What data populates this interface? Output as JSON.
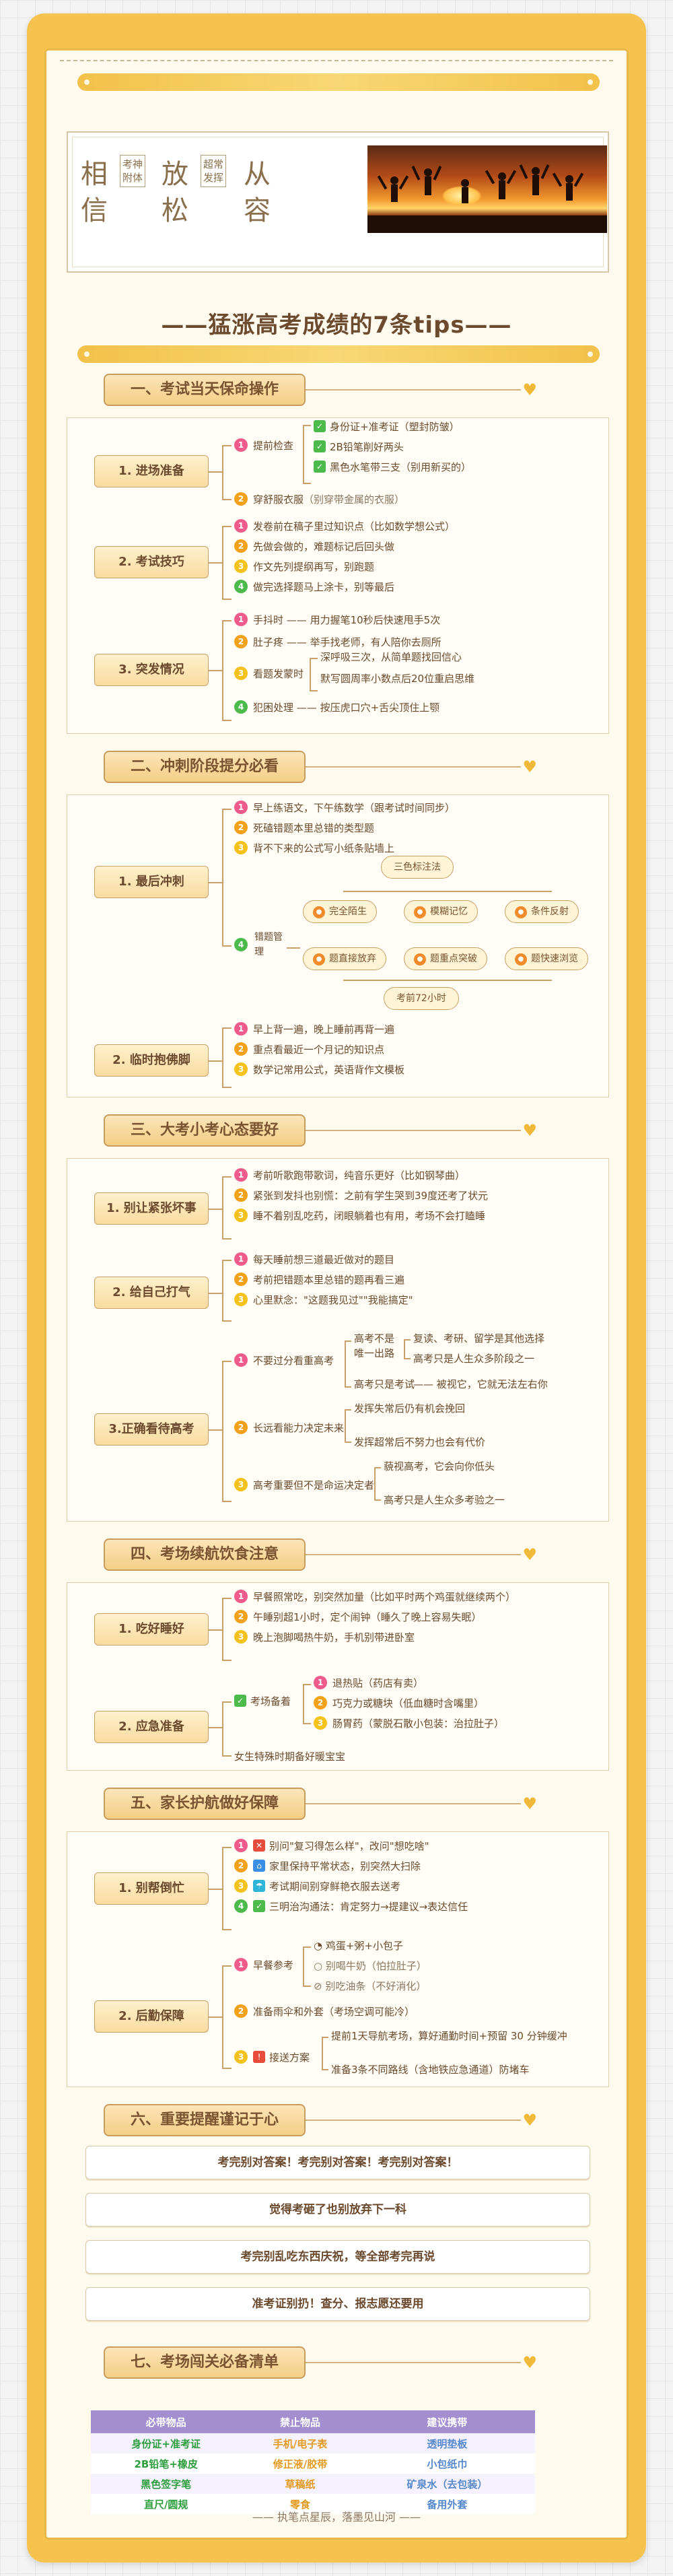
{
  "hero": {
    "word1": "相信",
    "v1": "考神附体",
    "word2": "放松",
    "v2": "超常发挥",
    "word3": "从容"
  },
  "main_title": "——猛涨高考成绩的7条tips——",
  "s1": {
    "title": "一、考试当天保命操作",
    "g1": {
      "label": "1. 进场准备",
      "a": "提前检查",
      "a_items": [
        "身份证+准考证（塑封防皱）",
        "2B铅笔削好两头",
        "黑色水笔带三支（别用新买的）"
      ],
      "b": "穿舒服衣服",
      "b_note": "（别穿带金属的衣服）"
    },
    "g2": {
      "label": "2. 考试技巧",
      "items": [
        "发卷前在稿子里过知识点（比如数学想公式）",
        "先做会做的，难题标记后回头做",
        "作文先列提纲再写，别跑题",
        "做完选择题马上涂卡，别等最后"
      ]
    },
    "g3": {
      "label": "3. 突发情况",
      "i1": "手抖时",
      "i1r": "用力握笔10秒后快速甩手5次",
      "i2": "肚子疼",
      "i2r": "举手找老师，有人陪你去厕所",
      "i3": "看题发蒙时",
      "i3a": "深呼吸三次，从简单题找回信心",
      "i3b": "默写圆周率小数点后20位重启思维",
      "i4": "犯困处理",
      "i4r": "按压虎口穴+舌尖顶住上颚"
    }
  },
  "s2": {
    "title": "二、冲刺阶段提分必看",
    "g1": {
      "label": "1. 最后冲刺",
      "items": [
        "早上练语文，下午练数学（跟考试时间同步）",
        "死磕错题本里总错的类型题",
        "背不下来的公式写小纸条贴墙上"
      ],
      "d": "错题管理",
      "top": "三色标注法",
      "caps1": [
        "完全陌生",
        "模糊记忆",
        "条件反射"
      ],
      "caps2": [
        "题直接放弃",
        "题重点突破",
        "题快速浏览"
      ],
      "bottom": "考前72小时"
    },
    "g2": {
      "label": "2. 临时抱佛脚",
      "items": [
        "早上背一遍，晚上睡前再背一遍",
        "重点看最近一个月记的知识点",
        "数学记常用公式，英语背作文模板"
      ]
    }
  },
  "s3": {
    "title": "三、大考小考心态要好",
    "g1": {
      "label": "1. 别让紧张坏事",
      "items": [
        "考前听歌跑带歌词，纯音乐更好（比如钢琴曲）",
        "紧张到发抖也别慌：之前有学生哭到39度还考了状元",
        "睡不着别乱吃药，闭眼躺着也有用，考场不会打瞌睡"
      ]
    },
    "g2": {
      "label": "2. 给自己打气",
      "items": [
        "每天睡前想三道最近做对的题目",
        "考前把错题本里总错的题再看三遍",
        "心里默念：\"这题我见过\"\"我能搞定\""
      ]
    },
    "g3": {
      "label": "3.正确看待高考",
      "i1": "不要过分看重高考",
      "i1a": "高考不是唯一出路",
      "i1a1": "复读、考研、留学是其他选择",
      "i1a2": "高考只是人生众多阶段之一",
      "i1b": "高考只是考试",
      "i1b1": "被视它，它就无法左右你",
      "i2": "长远看能力决定未来",
      "i2a": "发挥失常后仍有机会挽回",
      "i2b": "发挥超常后不努力也会有代价",
      "i3": "高考重要但不是命运决定者",
      "i3a": "藐视高考，它会向你低头",
      "i3b": "高考只是人生众多考验之一"
    }
  },
  "s4": {
    "title": "四、考场续航饮食注意",
    "g1": {
      "label": "1. 吃好睡好",
      "items": [
        "早餐照常吃，别突然加量（比如平时两个鸡蛋就继续两个）",
        "午睡别超1小时，定个闹钟（睡久了晚上容易失眠）",
        "晚上泡脚喝热牛奶，手机别带进卧室"
      ]
    },
    "g2": {
      "label": "2. 应急准备",
      "a": "考场备着",
      "a_items": [
        "退热贴（药店有卖）",
        "巧克力或糖块（低血糖时含嘴里）",
        "肠胃药（蒙脱石散小包装：治拉肚子）"
      ],
      "b": "女生特殊时期备好暖宝宝"
    }
  },
  "s5": {
    "title": "五、家长护航做好保障",
    "g1": {
      "label": "1. 别帮倒忙",
      "items": [
        "别问\"复习得怎么样\"，改问\"想吃啥\"",
        "家里保持平常状态，别突然大扫除",
        "考试期间别穿鲜艳衣服去送考",
        "三明治沟通法：肯定努力→提建议→表达信任"
      ]
    },
    "g2": {
      "label": "2. 后勤保障",
      "a": "早餐参考",
      "a_items": [
        "鸡蛋+粥+小包子",
        "别喝牛奶（怕拉肚子）",
        "别吃油条（不好消化）"
      ],
      "b": "准备雨伞和外套（考场空调可能冷）",
      "c": "接送方案",
      "c1": "提前1天导航考场，算好通勤时间+预留 30 分钟缓冲",
      "c2": "准备3条不同路线（含地铁应急通道）防堵车"
    }
  },
  "s6": {
    "title": "六、重要提醒谨记于心",
    "items": [
      "考完别对答案！考完别对答案！考完别对答案！",
      "觉得考砸了也别放弃下一科",
      "考完别乱吃东西庆祝，等全部考完再说",
      "准考证别扔！查分、报志愿还要用"
    ]
  },
  "s7": {
    "title": "七、考场闯关必备清单",
    "headers": [
      "必带物品",
      "禁止物品",
      "建议携带"
    ],
    "rows": [
      [
        "身份证+准考证",
        "手机/电子表",
        "透明垫板"
      ],
      [
        "2B铅笔+橡皮",
        "修正液/胶带",
        "小包纸巾"
      ],
      [
        "黑色签字笔",
        "草稿纸",
        "矿泉水（去包装）"
      ],
      [
        "直尺/圆规",
        "零食",
        "备用外套"
      ]
    ]
  },
  "footer": "—— 执笔点星辰，落墨见山河 ——",
  "colors": {
    "frame": "#f6c44e",
    "accent": "#c89c5c",
    "table_header": "#a38fd0"
  }
}
